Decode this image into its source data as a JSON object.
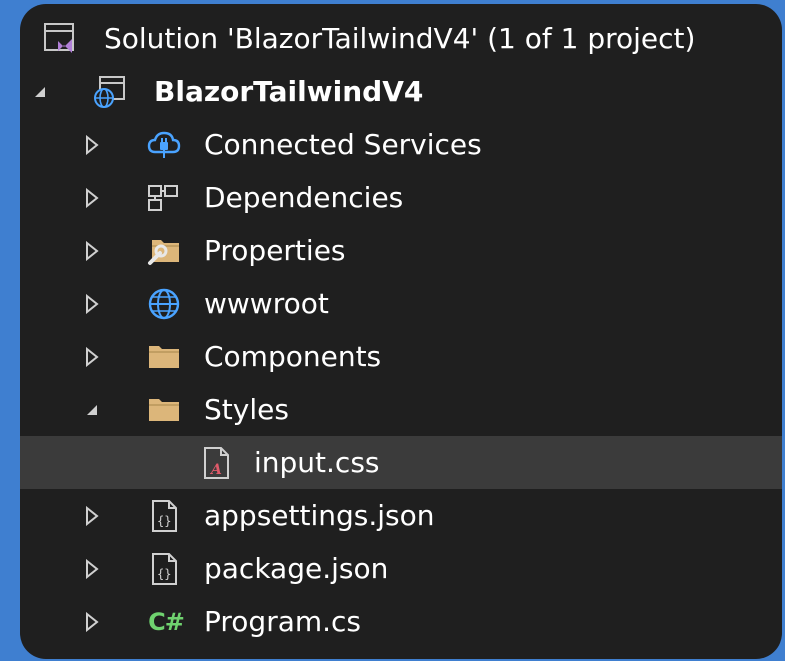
{
  "solution_explorer": {
    "solution_label": "Solution 'BlazorTailwindV4' (1 of 1 project)",
    "project_label": "BlazorTailwindV4",
    "items": [
      {
        "label": "Connected Services"
      },
      {
        "label": "Dependencies"
      },
      {
        "label": "Properties"
      },
      {
        "label": "wwwroot"
      },
      {
        "label": "Components"
      },
      {
        "label": "Styles"
      },
      {
        "label": "input.css"
      },
      {
        "label": "appsettings.json"
      },
      {
        "label": "package.json"
      },
      {
        "label": "Program.cs"
      }
    ],
    "csharp_glyph": "C#"
  },
  "colors": {
    "background": "#3f7fd0",
    "panel": "#1f1f1f",
    "selected_row": "#3b3b3b",
    "text": "#ffffff",
    "folder": "#dcb67a",
    "globe": "#4aa3ff",
    "csharp": "#6fd26f"
  }
}
